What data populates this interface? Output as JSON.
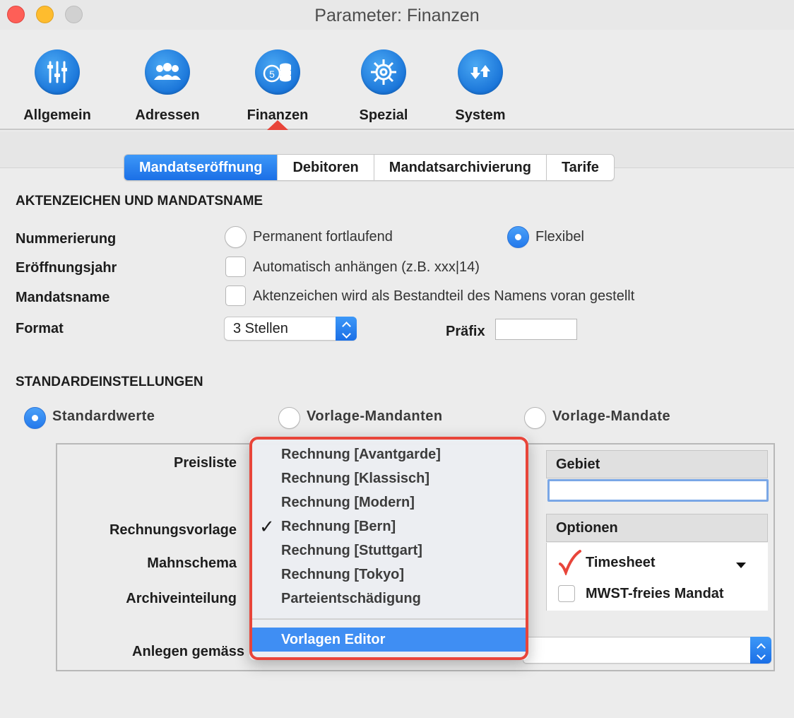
{
  "window": {
    "title": "Parameter: Finanzen"
  },
  "toolbar": {
    "items": [
      {
        "label": "Allgemein",
        "icon": "sliders-icon"
      },
      {
        "label": "Adressen",
        "icon": "people-icon"
      },
      {
        "label": "Finanzen",
        "icon": "coins-icon"
      },
      {
        "label": "Spezial",
        "icon": "helm-icon"
      },
      {
        "label": "System",
        "icon": "arrows-icon"
      }
    ],
    "selected": "Finanzen"
  },
  "tabs": [
    {
      "label": "Mandatseröffnung",
      "active": true
    },
    {
      "label": "Debitoren",
      "active": false
    },
    {
      "label": "Mandatsarchivierung",
      "active": false
    },
    {
      "label": "Tarife",
      "active": false
    }
  ],
  "aktenzeichen": {
    "section_title": "AKTENZEICHEN UND MANDATSNAME",
    "nummerierung": {
      "label": "Nummerierung",
      "options": [
        {
          "label": "Permanent fortlaufend",
          "selected": false
        },
        {
          "label": "Flexibel",
          "selected": true
        }
      ]
    },
    "eroeffnungsjahr": {
      "label": "Eröffnungsjahr",
      "checkbox_label": "Automatisch anhängen (z.B. xxx|14)",
      "checked": false
    },
    "mandatsname": {
      "label": "Mandatsname",
      "checkbox_label": "Aktenzeichen wird als Bestandteil des Namens voran gestellt",
      "checked": false
    },
    "format": {
      "label": "Format",
      "value": "3 Stellen",
      "praefix_label": "Präfix",
      "praefix_value": ""
    }
  },
  "standard": {
    "section_title": "STANDARDEINSTELLUNGEN",
    "options": [
      {
        "label": "Standardwerte",
        "selected": true
      },
      {
        "label": "Vorlage-Mandanten",
        "selected": false
      },
      {
        "label": "Vorlage-Mandate",
        "selected": false
      }
    ],
    "fields": {
      "preisliste": "Preisliste",
      "rechnungsvorlage": "Rechnungsvorlage",
      "mahnschema": "Mahnschema",
      "archiveinteilung": "Archiveinteilung",
      "anlegen_gemaess": "Anlegen gemäss"
    },
    "gebiet": {
      "header": "Gebiet",
      "value": ""
    },
    "optionen": {
      "header": "Optionen",
      "items": [
        {
          "label": "Timesheet",
          "checked": true
        },
        {
          "label": "MWST-freies Mandat",
          "checked": false
        }
      ]
    }
  },
  "menu": {
    "items": [
      {
        "label": "Rechnung [Avantgarde]",
        "checked": false
      },
      {
        "label": "Rechnung [Klassisch]",
        "checked": false
      },
      {
        "label": "Rechnung [Modern]",
        "checked": false
      },
      {
        "label": "Rechnung [Bern]",
        "checked": true
      },
      {
        "label": "Rechnung [Stuttgart]",
        "checked": false
      },
      {
        "label": "Rechnung [Tokyo]",
        "checked": false
      },
      {
        "label": "Parteientschädigung",
        "checked": false
      }
    ],
    "editor": "Vorlagen Editor",
    "check_mark": "✓",
    "highlight_color": "#e8453a"
  }
}
